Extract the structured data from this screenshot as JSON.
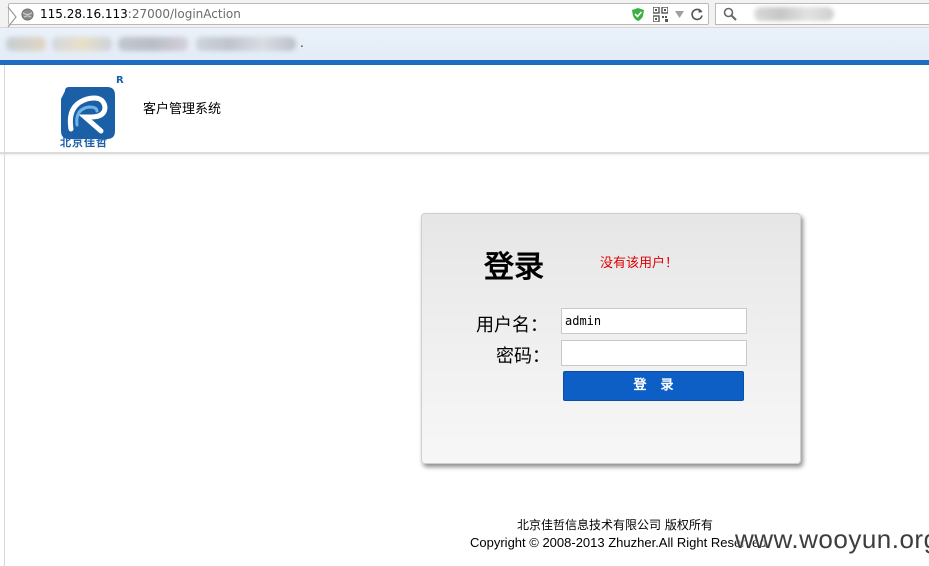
{
  "browser": {
    "url_host": "115.28.16.113",
    "url_rest": ":27000/loginAction",
    "bookmarks_dot": "."
  },
  "header": {
    "logo_text": "北京佳哲",
    "logo_mark": "R",
    "system_title": "客户管理系统"
  },
  "login": {
    "heading": "登录",
    "error_message": "没有该用户！",
    "username_label": "用户名：",
    "username_value": "admin",
    "password_label": "密码：",
    "password_value": "",
    "submit_label": "登录"
  },
  "footer": {
    "company": "北京佳哲信息技术有限公司 版权所有",
    "copyright": "Copyright © 2008-2013 Zhuzher.All Right Reserved"
  },
  "watermark": "www.wooyun.org",
  "colors": {
    "accent_blue": "#0d5fc6",
    "error_red": "#e00000",
    "strip_blue": "#1f6bc2"
  }
}
